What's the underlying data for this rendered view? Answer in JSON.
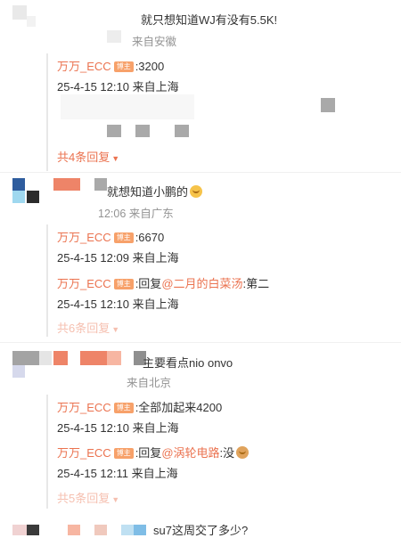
{
  "threads": [
    {
      "comment_text": "就只想知道WJ有没有5.5K!",
      "comment_meta": "来自安徽",
      "replies": [
        {
          "author": "万万_ECC",
          "badge": "博主",
          "text": ":3200",
          "meta": "25-4-15 12:10 来自上海"
        }
      ],
      "more": "共4条回复"
    },
    {
      "comment_text": "就想知道小鹏的",
      "comment_meta": "12:06 来自广东",
      "replies": [
        {
          "author": "万万_ECC",
          "badge": "博主",
          "text": ":6670",
          "meta": "25-4-15 12:09 来自上海"
        },
        {
          "author": "万万_ECC",
          "badge": "博主",
          "prefix": ":回复",
          "mention": "@二月的白菜汤",
          "suffix": ":第二",
          "meta": "25-4-15 12:10 来自上海"
        }
      ],
      "more": "共6条回复"
    },
    {
      "comment_text": "主要看点nio onvo",
      "comment_meta": "来自北京",
      "replies": [
        {
          "author": "万万_ECC",
          "badge": "博主",
          "text": ":全部加起来4200",
          "meta": "25-4-15 12:10 来自上海"
        },
        {
          "author": "万万_ECC",
          "badge": "博主",
          "prefix": ":回复",
          "mention": "@涡轮电路",
          "suffix": ":没",
          "meta": "25-4-15 12:11 来自上海"
        }
      ],
      "more": "共5条回复"
    },
    {
      "comment_text": "su7这周交了多少?"
    }
  ],
  "colors": {
    "author": "#eb7350",
    "badge": "#f7a16a",
    "meta": "#939393",
    "text": "#333333"
  }
}
